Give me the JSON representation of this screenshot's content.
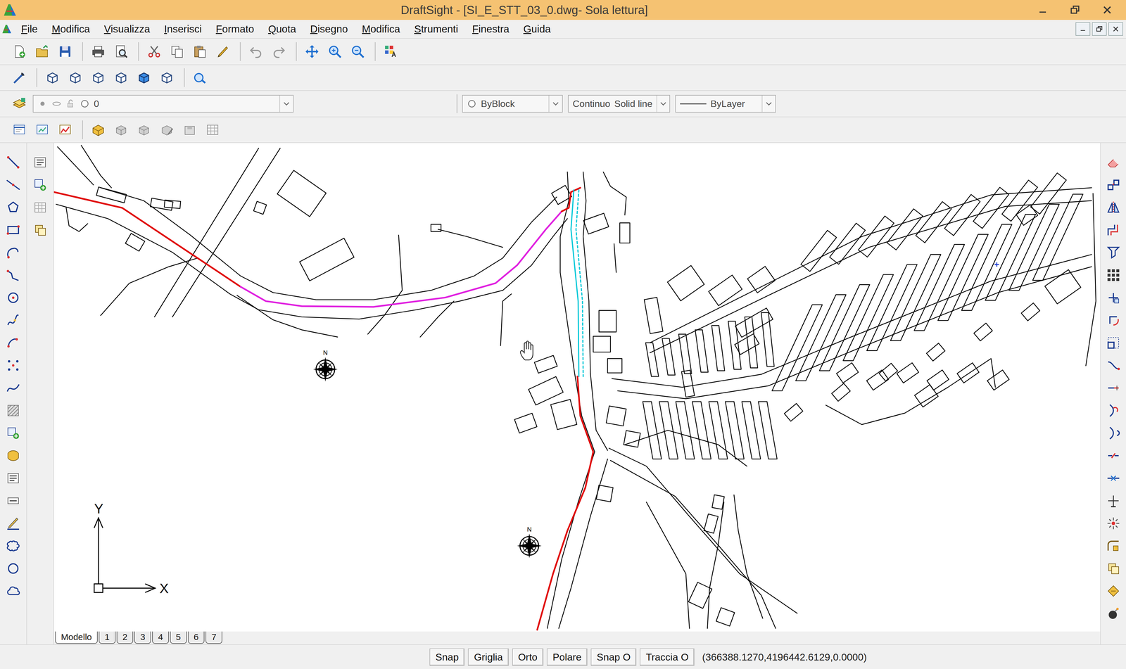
{
  "window": {
    "title": "DraftSight - [SI_E_STT_03_0.dwg- Sola lettura]"
  },
  "menu": [
    {
      "label": "File"
    },
    {
      "label": "Modifica"
    },
    {
      "label": "Visualizza"
    },
    {
      "label": "Inserisci"
    },
    {
      "label": "Formato"
    },
    {
      "label": "Quota"
    },
    {
      "label": "Disegno"
    },
    {
      "label": "Modifica"
    },
    {
      "label": "Strumenti"
    },
    {
      "label": "Finestra"
    },
    {
      "label": "Guida"
    }
  ],
  "layer_bar": {
    "layer": "0",
    "color": "ByBlock",
    "linetype": "Continuo",
    "linetype_description": "Solid line",
    "lineweight": "ByLayer"
  },
  "drawing": {
    "axis_x": "X",
    "axis_y": "Y",
    "compass_label": "N"
  },
  "tabs": [
    {
      "label": "Modello",
      "selected": true
    },
    {
      "label": "1",
      "selected": false
    },
    {
      "label": "2",
      "selected": false
    },
    {
      "label": "3",
      "selected": false
    },
    {
      "label": "4",
      "selected": false
    },
    {
      "label": "5",
      "selected": false
    },
    {
      "label": "6",
      "selected": false
    },
    {
      "label": "7",
      "selected": false
    }
  ],
  "status_bar": {
    "toggles": [
      {
        "label": "Snap"
      },
      {
        "label": "Griglia"
      },
      {
        "label": "Orto"
      },
      {
        "label": "Polare"
      },
      {
        "label": "Snap O"
      },
      {
        "label": "Traccia O"
      }
    ],
    "coordinates": "(366388.1270,4196442.6129,0.0000)"
  }
}
